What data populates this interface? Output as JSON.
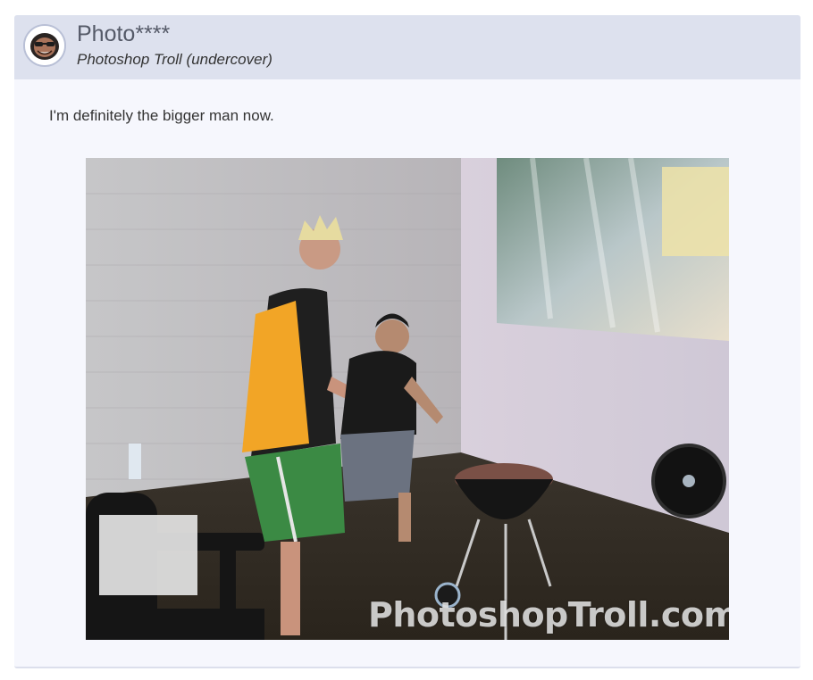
{
  "post": {
    "username": "Photo****",
    "user_title": "Photoshop Troll (undercover)",
    "message": "I'm definitely the bigger man now.",
    "avatar_icon": "troll-face-avatar-icon"
  },
  "image": {
    "watermark": "PhotoshopTroll.com",
    "description_icon": "bbq-photo-icon"
  },
  "colors": {
    "header_bg": "#dde1ee",
    "card_bg": "#f6f7fd",
    "username": "#555a68"
  }
}
